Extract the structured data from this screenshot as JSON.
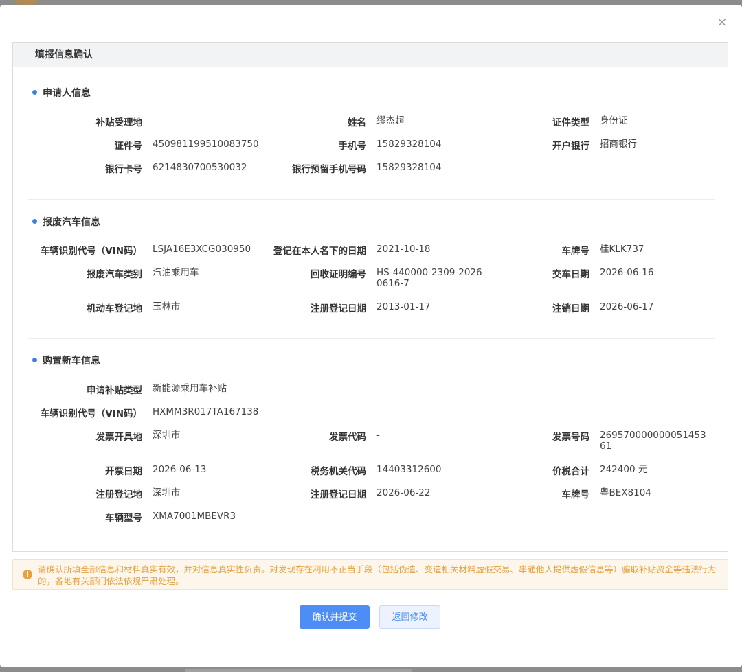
{
  "dialog": {
    "close_label": "×",
    "panel_title": "填报信息确认"
  },
  "applicant": {
    "title": "申请人信息",
    "fields": [
      {
        "label": "补贴受理地",
        "value": ""
      },
      {
        "label": "姓名",
        "value": "缪杰超"
      },
      {
        "label": "证件类型",
        "value": "身份证"
      },
      {
        "label": "证件号",
        "value": "450981199510083750"
      },
      {
        "label": "手机号",
        "value": "15829328104"
      },
      {
        "label": "开户银行",
        "value": "招商银行"
      },
      {
        "label": "银行卡号",
        "value": "6214830700530032"
      },
      {
        "label": "银行预留手机号码",
        "value": "15829328104"
      }
    ]
  },
  "scrap_vehicle": {
    "title": "报废汽车信息",
    "fields": [
      {
        "label": "车辆识别代号（VIN码）",
        "value": "LSJA16E3XCG030950"
      },
      {
        "label": "登记在本人名下的日期",
        "value": "2021-10-18"
      },
      {
        "label": "车牌号",
        "value": "桂KLK737"
      },
      {
        "label": "报废汽车类别",
        "value": "汽油乘用车"
      },
      {
        "label": "回收证明编号",
        "value": "HS-440000-2309-20260616-7"
      },
      {
        "label": "交车日期",
        "value": "2026-06-16"
      },
      {
        "label": "机动车登记地",
        "value": "玉林市"
      },
      {
        "label": "注册登记日期",
        "value": "2013-01-17"
      },
      {
        "label": "注销日期",
        "value": "2026-06-17"
      }
    ]
  },
  "new_vehicle": {
    "title": "购置新车信息",
    "fields": [
      {
        "label": "申请补贴类型",
        "value": "新能源乘用车补贴"
      },
      {
        "label": "车辆识别代号（VIN码）",
        "value": "HXMM3R017TA167138"
      },
      {
        "label": "发票开具地",
        "value": "深圳市"
      },
      {
        "label": "发票代码",
        "value": "-"
      },
      {
        "label": "发票号码",
        "value": "26957000000005145361"
      },
      {
        "label": "开票日期",
        "value": "2026-06-13"
      },
      {
        "label": "税务机关代码",
        "value": "14403312600"
      },
      {
        "label": "价税合计",
        "value": "242400 元"
      },
      {
        "label": "注册登记地",
        "value": "深圳市"
      },
      {
        "label": "注册登记日期",
        "value": "2026-06-22"
      },
      {
        "label": "车牌号",
        "value": "粤BEX8104"
      },
      {
        "label": "车辆型号",
        "value": "XMA7001MBEVR3"
      }
    ]
  },
  "notice": {
    "icon": "warning-icon",
    "icon_glyph": "!",
    "text": "请确认所填全部信息和材料真实有效，并对信息真实性负责。对发现存在利用不正当手段（包括伪造、变造相关材料虚假交易、串通他人提供虚假信息等）骗取补贴资金等违法行为的，各地有关部门依法依规严肃处理。",
    "color": "#e6a23c"
  },
  "actions": {
    "confirm_label": "确认并提交",
    "back_label": "返回修改",
    "primary_color": "#4c8df6"
  }
}
